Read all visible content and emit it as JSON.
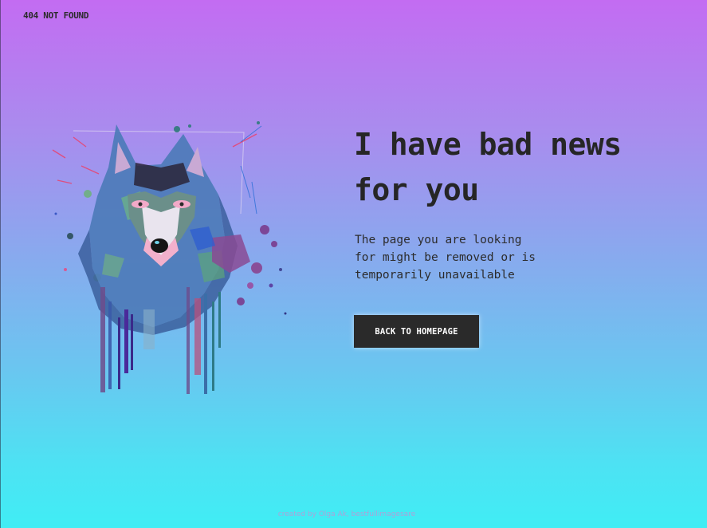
{
  "header": {
    "brand": "404 NOT FOUND"
  },
  "illustration": {
    "icon": "wolf-watercolor-illustration"
  },
  "main": {
    "headline": "I have bad news for you",
    "message": "The page you are looking for might be removed or is temporarily unavailable",
    "button_label": "BACK TO HOMEPAGE"
  },
  "footer": {
    "credit": "created by Olga Ak, bestfullimagesare"
  },
  "colors": {
    "gradient_top": "#c36cf2",
    "gradient_bottom": "#40edf4",
    "button_bg": "#2a2a2a",
    "text": "#262626"
  }
}
